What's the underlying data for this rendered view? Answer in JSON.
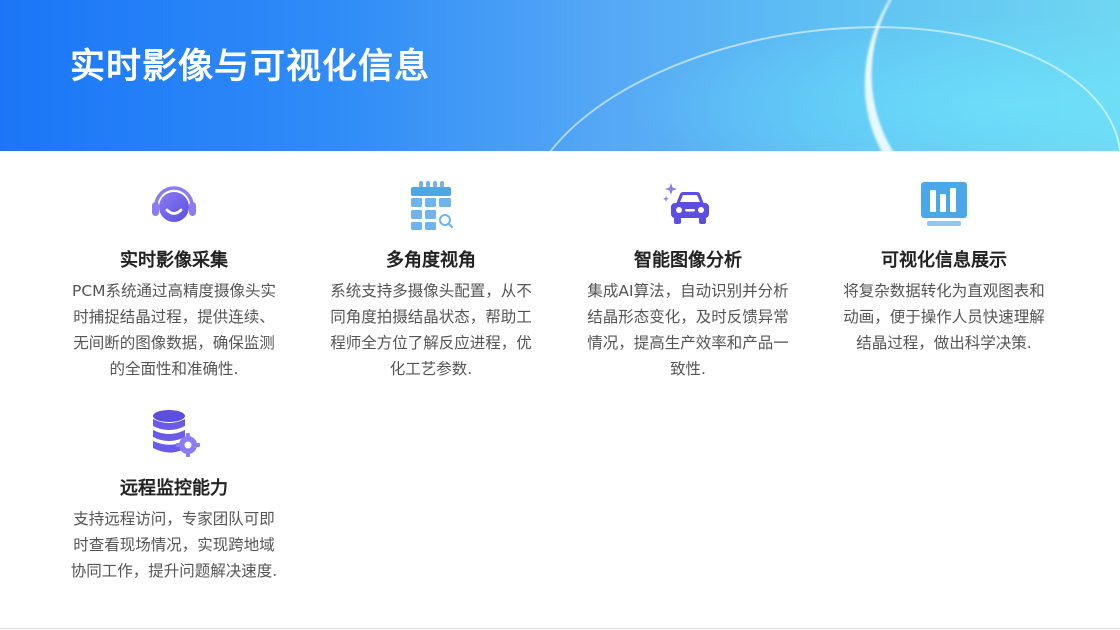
{
  "header": {
    "title": "实时影像与可视化信息"
  },
  "colors": {
    "banner_start": "#1b76f7",
    "banner_end": "#6fd6f2",
    "icon_purple": "#6a5ae8",
    "icon_blue": "#4aa8e8"
  },
  "features": [
    {
      "icon": "headset-icon",
      "title": "实时影像采集",
      "desc": "PCM系统通过高精度摄像头实时捕捉结晶过程，提供连续、无间断的图像数据，确保监测的全面性和准确性."
    },
    {
      "icon": "camera-grid-icon",
      "title": "多角度视角",
      "desc": "系统支持多摄像头配置，从不同角度拍摄结晶状态，帮助工程师全方位了解反应进程，优化工艺参数."
    },
    {
      "icon": "ai-car-icon",
      "title": "智能图像分析",
      "desc": "集成AI算法，自动识别并分析结晶形态变化，及时反馈异常情况，提高生产效率和产品一致性."
    },
    {
      "icon": "monitor-chart-icon",
      "title": "可视化信息展示",
      "desc": "将复杂数据转化为直观图表和动画，便于操作人员快速理解结晶过程，做出科学决策."
    },
    {
      "icon": "database-gear-icon",
      "title": "远程监控能力",
      "desc": "支持远程访问，专家团队可即时查看现场情况，实现跨地域协同工作，提升问题解决速度."
    }
  ]
}
